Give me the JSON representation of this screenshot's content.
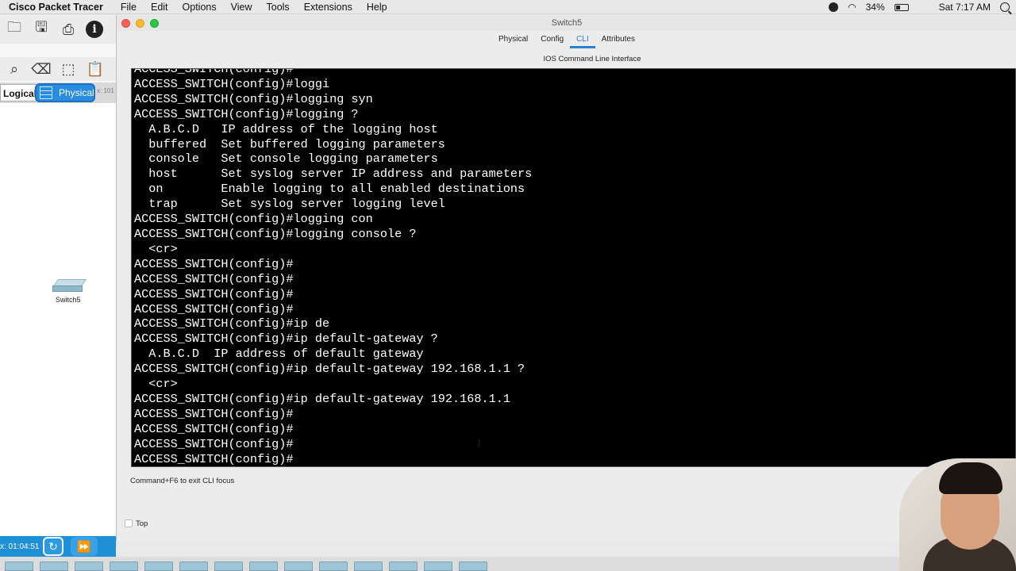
{
  "menubar": {
    "app": "Cisco Packet Tracer",
    "items": [
      "File",
      "Edit",
      "Options",
      "View",
      "Tools",
      "Extensions",
      "Help"
    ],
    "battery": "34%",
    "clock": "Sat 7:17 AM"
  },
  "workspace": {
    "logical_label": "Logical",
    "physical_label": "Physical",
    "x_coord": "x: 101",
    "device_label": "Switch5",
    "time": "x: 01:04:51"
  },
  "window": {
    "title": "Switch5",
    "tabs": [
      "Physical",
      "Config",
      "CLI",
      "Attributes"
    ],
    "active_tab": "CLI",
    "cli_header": "IOS Command Line Interface",
    "terminal_lines": [
      "ACCESS_SWITCH(config)#",
      "ACCESS_SWITCH(config)#loggi",
      "ACCESS_SWITCH(config)#logging syn",
      "ACCESS_SWITCH(config)#logging ?",
      "  A.B.C.D   IP address of the logging host",
      "  buffered  Set buffered logging parameters",
      "  console   Set console logging parameters",
      "  host      Set syslog server IP address and parameters",
      "  on        Enable logging to all enabled destinations",
      "  trap      Set syslog server logging level",
      "ACCESS_SWITCH(config)#logging con",
      "ACCESS_SWITCH(config)#logging console ?",
      "  <cr>",
      "ACCESS_SWITCH(config)#",
      "ACCESS_SWITCH(config)#",
      "ACCESS_SWITCH(config)#",
      "ACCESS_SWITCH(config)#",
      "ACCESS_SWITCH(config)#ip de",
      "ACCESS_SWITCH(config)#ip default-gateway ?",
      "  A.B.C.D  IP address of default gateway",
      "ACCESS_SWITCH(config)#ip default-gateway 192.168.1.1 ?",
      "  <cr>",
      "ACCESS_SWITCH(config)#ip default-gateway 192.168.1.1",
      "ACCESS_SWITCH(config)#",
      "ACCESS_SWITCH(config)#",
      "ACCESS_SWITCH(config)#",
      "ACCESS_SWITCH(config)#"
    ],
    "exit_hint": "Command+F6 to exit CLI focus",
    "top_label": "Top"
  },
  "colors": {
    "accent": "#2a7fd4",
    "terminal_bg": "#000000",
    "terminal_fg": "#ffffff",
    "bottom_bar": "#1f8fd6"
  }
}
